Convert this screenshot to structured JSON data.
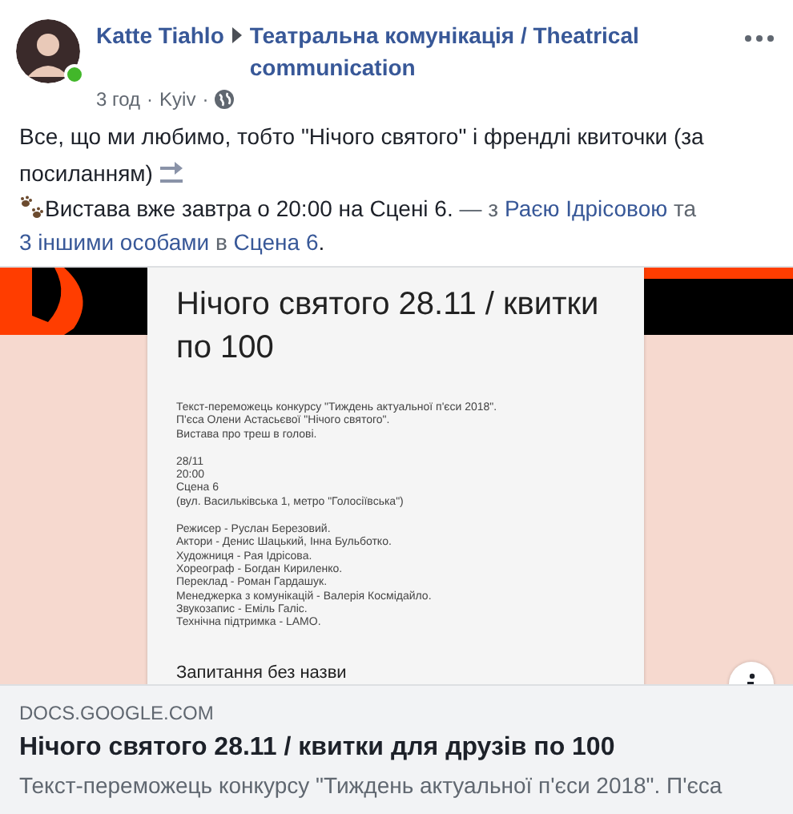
{
  "post": {
    "author": "Katte Tiahlo",
    "online": true,
    "group": "Театральна комунікація / Theatrical communication",
    "meta": [
      {
        "kind": "time",
        "text": "3 год"
      },
      {
        "kind": "separator",
        "text": "·"
      },
      {
        "kind": "location",
        "text": "Kyiv"
      },
      {
        "kind": "separator",
        "text": "·"
      },
      {
        "kind": "globe"
      }
    ],
    "paragraphs": [
      {
        "segments": [
          {
            "kind": "line",
            "text": "Все, що ми любимо, тобто \"Нічого святого\" і френдлі квиточки (за"
          },
          {
            "kind": "text",
            "text": "посиланням)"
          },
          {
            "kind": "soon-emoji"
          }
        ]
      },
      {
        "segments": [
          {
            "kind": "paw-emoji"
          },
          {
            "kind": "text",
            "text": "Вистава вже завтра о 20:00 на Сцені 6."
          },
          {
            "kind": "muted",
            "text": " — з "
          },
          {
            "kind": "link",
            "text": "Раєю Ідрісовою"
          },
          {
            "kind": "muted",
            "text": " та "
          },
          {
            "kind": "link",
            "text": "3 іншими особами"
          },
          {
            "kind": "muted",
            "text": " в "
          },
          {
            "kind": "link",
            "text": "Сцена 6"
          },
          {
            "kind": "text",
            "text": "."
          }
        ]
      }
    ]
  },
  "preview": {
    "document": {
      "title": "Нічого святого 28.11 / квитки по 100",
      "blocks": [
        {
          "lines": [
            "Текст-переможець конкурсу \"Тиждень актуальної п'єси 2018\".",
            "П'єса Олени Астасьєвої \"Нічого святого\".",
            "Вистава про треш в голові."
          ]
        },
        {
          "lines": [
            "28/11",
            "20:00",
            "Сцена 6",
            "(вул. Васильківська 1, метро \"Голосіївська\")"
          ]
        },
        {
          "lines": [
            "Режисер - Руслан Березовий.",
            "Актори - Денис Шацький, Інна Бульботко.",
            "Художниця - Рая Ідрісова.",
            "Хореограф - Богдан Кириленко.",
            "Переклад - Роман Гардашук.",
            "Менеджерка з комунікацій - Валерія Космідайло.",
            "Звукозапис - Еміль Галіс.",
            "Технічна підтримка - LAMO."
          ]
        }
      ],
      "question": "Запитання без назви"
    },
    "domain": "DOCS.GOOGLE.COM",
    "title": "Нічого святого 28.11 / квитки для друзів по 100",
    "description": "Текст-переможець конкурсу \"Тиждень актуальної п'єси 2018\". П'єса"
  }
}
